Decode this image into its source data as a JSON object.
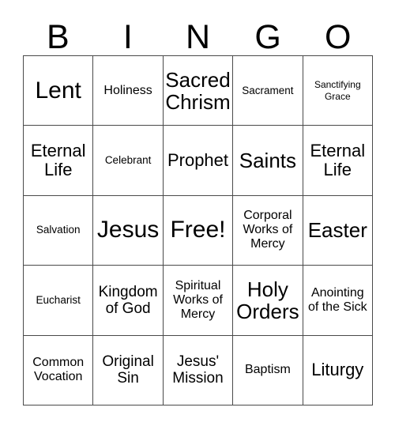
{
  "card": {
    "header_letters": [
      "B",
      "I",
      "N",
      "G",
      "O"
    ],
    "grid_size": 5,
    "border_color": "#4a4a4a",
    "background_color": "#ffffff",
    "text_color": "#000000",
    "rows": [
      [
        {
          "text": "Lent",
          "size": "fs-xxl"
        },
        {
          "text": "Holiness",
          "size": "fs-sm"
        },
        {
          "text": "Sacred Chrism",
          "size": "fs-xl"
        },
        {
          "text": "Sacrament",
          "size": "fs-xs"
        },
        {
          "text": "Sanctifying Grace",
          "size": "fs-xxs"
        }
      ],
      [
        {
          "text": "Eternal Life",
          "size": "fs-lg"
        },
        {
          "text": "Celebrant",
          "size": "fs-xs"
        },
        {
          "text": "Prophet",
          "size": "fs-lg"
        },
        {
          "text": "Saints",
          "size": "fs-xl"
        },
        {
          "text": "Eternal Life",
          "size": "fs-lg"
        }
      ],
      [
        {
          "text": "Salvation",
          "size": "fs-xs"
        },
        {
          "text": "Jesus",
          "size": "fs-xxl"
        },
        {
          "text": "Free!",
          "size": "fs-xxl"
        },
        {
          "text": "Corporal Works of Mercy",
          "size": "fs-sm"
        },
        {
          "text": "Easter",
          "size": "fs-xl"
        }
      ],
      [
        {
          "text": "Eucharist",
          "size": "fs-xs"
        },
        {
          "text": "Kingdom of God",
          "size": "fs-md"
        },
        {
          "text": "Spiritual Works of Mercy",
          "size": "fs-sm"
        },
        {
          "text": "Holy Orders",
          "size": "fs-xl"
        },
        {
          "text": "Anointing of the Sick",
          "size": "fs-sm"
        }
      ],
      [
        {
          "text": "Common Vocation",
          "size": "fs-sm"
        },
        {
          "text": "Original Sin",
          "size": "fs-md"
        },
        {
          "text": "Jesus' Mission",
          "size": "fs-md"
        },
        {
          "text": "Baptism",
          "size": "fs-sm"
        },
        {
          "text": "Liturgy",
          "size": "fs-lg"
        }
      ]
    ]
  }
}
